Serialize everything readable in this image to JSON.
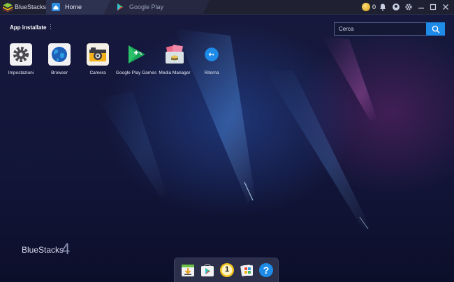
{
  "window": {
    "app_name": "BlueStacks",
    "tabs": [
      {
        "label": "Home",
        "active": true,
        "icon": "home-icon"
      },
      {
        "label": "Google Play",
        "active": false,
        "icon": "play-store-icon"
      }
    ],
    "coins": "0",
    "controls": [
      "notification-icon",
      "account-icon",
      "settings-icon",
      "minimize-icon",
      "maximize-icon",
      "close-icon"
    ]
  },
  "home": {
    "section_title": "App installate",
    "menu_glyph": "⋮",
    "search": {
      "placeholder": "Cerca"
    },
    "apps": [
      {
        "label": "Impostazioni",
        "icon": "settings-gear-icon"
      },
      {
        "label": "Browser",
        "icon": "globe-icon"
      },
      {
        "label": "Camera",
        "icon": "camera-icon"
      },
      {
        "label": "Google Play Games",
        "icon": "play-games-icon"
      },
      {
        "label": "Media Manager",
        "icon": "media-manager-icon"
      },
      {
        "label": "Ritorna",
        "icon": "back-icon"
      }
    ],
    "brand": {
      "name": "BlueStacks",
      "version": "4"
    }
  },
  "dock": {
    "items": [
      "install-apk-icon",
      "play-store-icon",
      "rewards-badge-icon",
      "multi-instance-icon",
      "help-icon"
    ],
    "badge_number": "1",
    "help_glyph": "?"
  },
  "colors": {
    "accent": "#1e8be8",
    "titlebar": "#1f2133",
    "desktop": "#141738"
  }
}
